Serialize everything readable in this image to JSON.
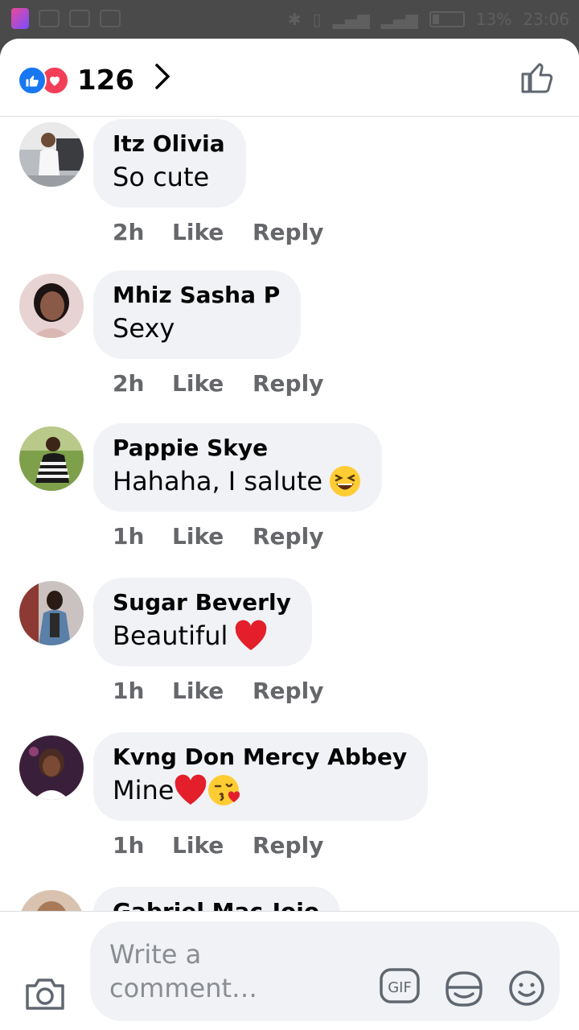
{
  "status_bar": {
    "battery": "13%",
    "time": "23:06"
  },
  "header": {
    "reaction_count": "126",
    "reactions": [
      "like-icon",
      "love-icon"
    ]
  },
  "comments": [
    {
      "author": "Itz Olivia",
      "text": "So cute",
      "emoji": "",
      "time": "2h",
      "like": "Like",
      "reply": "Reply"
    },
    {
      "author": "Mhiz Sasha P",
      "text": "Sexy",
      "emoji": "",
      "time": "2h",
      "like": "Like",
      "reply": "Reply"
    },
    {
      "author": "Pappie Skye",
      "text": "Hahaha, I salute",
      "emoji": "laughing-emoji",
      "time": "1h",
      "like": "Like",
      "reply": "Reply"
    },
    {
      "author": "Sugar Beverly",
      "text": "Beautiful",
      "emoji": "red-heart-emoji",
      "time": "1h",
      "like": "Like",
      "reply": "Reply"
    },
    {
      "author": "Kvng Don Mercy Abbey",
      "text": "Mine",
      "emoji": "heart-kiss-emoji",
      "time": "1h",
      "like": "Like",
      "reply": "Reply"
    },
    {
      "author": "Gabriel Mac-Jojo",
      "text": "",
      "emoji": "",
      "time": "",
      "like": "",
      "reply": ""
    }
  ],
  "composer": {
    "placeholder": "Write a comment…",
    "gif_label": "GIF"
  },
  "colors": {
    "bubble": "#f0f2f5",
    "meta_text": "#65676b",
    "like_blue": "#1877f2",
    "love_red": "#f33e58"
  }
}
